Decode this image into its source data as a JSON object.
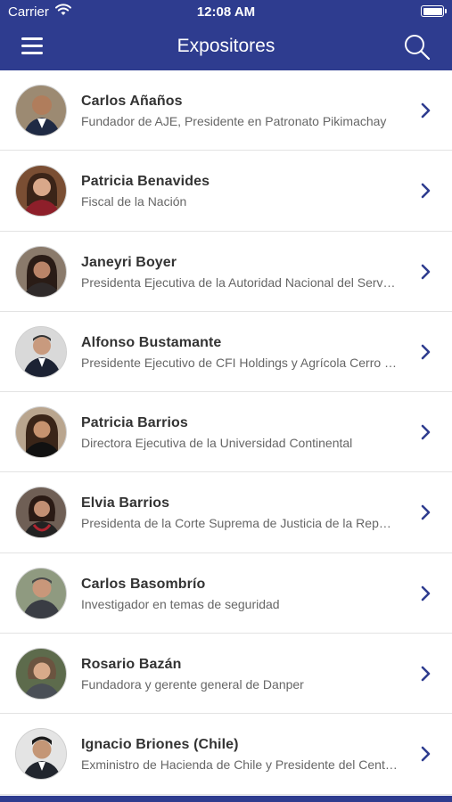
{
  "status_bar": {
    "carrier": "Carrier",
    "time": "12:08 AM"
  },
  "nav": {
    "title": "Expositores",
    "menu_icon": "hamburger-menu-icon",
    "search_icon": "search-icon"
  },
  "colors": {
    "nav_bg": "#2e3c8f",
    "chevron": "#2e3c8f"
  },
  "speakers": [
    {
      "name": "Carlos Añaños",
      "description": "Fundador de AJE, Presidente en Patronato Pikimachay"
    },
    {
      "name": "Patricia Benavides",
      "description": "Fiscal de la Nación"
    },
    {
      "name": "Janeyri Boyer",
      "description": "Presidenta Ejecutiva de la Autoridad Nacional del Servicio Civil"
    },
    {
      "name": "Alfonso Bustamante",
      "description": "Presidente Ejecutivo de CFI Holdings y Agrícola Cerro Prieto"
    },
    {
      "name": "Patricia Barrios",
      "description": "Directora Ejecutiva de la Universidad Continental"
    },
    {
      "name": "Elvia Barrios",
      "description": "Presidenta de la Corte Suprema de Justicia de la República"
    },
    {
      "name": "Carlos Basombrío",
      "description": "Investigador en temas de seguridad"
    },
    {
      "name": "Rosario Bazán",
      "description": "Fundadora y gerente general de Danper"
    },
    {
      "name": "Ignacio Briones (Chile)",
      "description": "Exministro de Hacienda de Chile y Presidente del Centro de Estudios"
    }
  ]
}
